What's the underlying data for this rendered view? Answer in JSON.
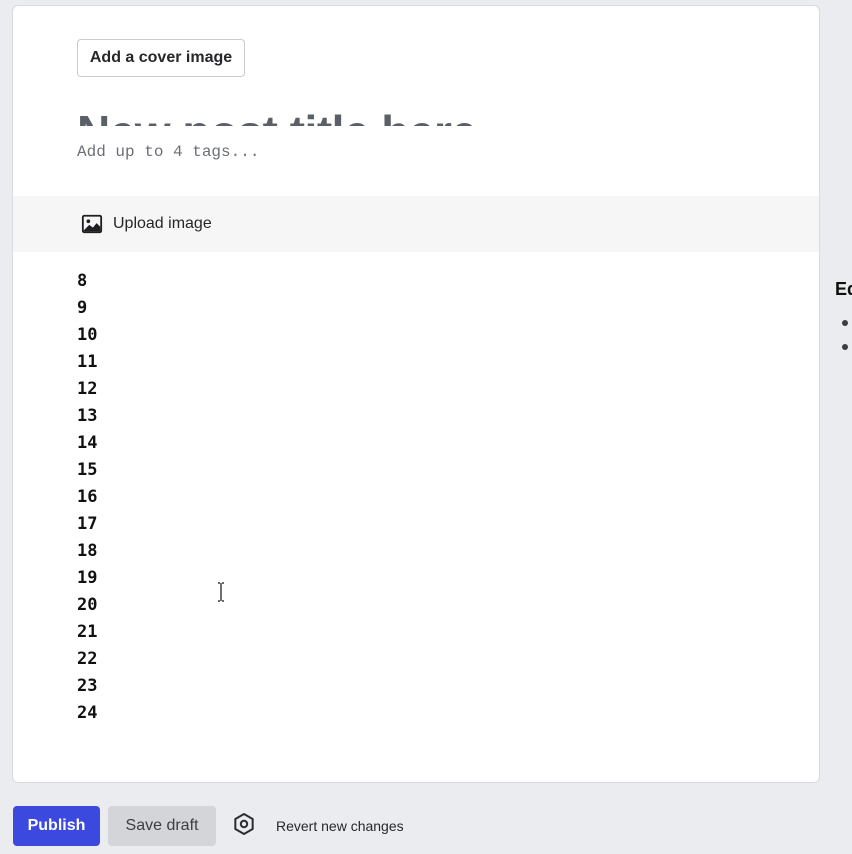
{
  "editor": {
    "cover_button_label": "Add a cover image",
    "title_placeholder": "New post title here...",
    "tags_placeholder": "Add up to 4 tags...",
    "toolbar": {
      "upload_label": "Upload image",
      "upload_icon": "image-icon"
    },
    "body_lines": [
      "8",
      "9",
      "10",
      "11",
      "12",
      "13",
      "14",
      "15",
      "16",
      "17",
      "18",
      "19",
      "20",
      "21",
      "22",
      "23",
      "24"
    ]
  },
  "sidebar": {
    "heading": "Ed",
    "bullet_count": 2
  },
  "footer": {
    "publish_label": "Publish",
    "save_draft_label": "Save draft",
    "settings_icon": "hexagon-gear-icon",
    "revert_label": "Revert new changes"
  },
  "colors": {
    "primary": "#3b49df",
    "page_background": "#ebecef"
  }
}
